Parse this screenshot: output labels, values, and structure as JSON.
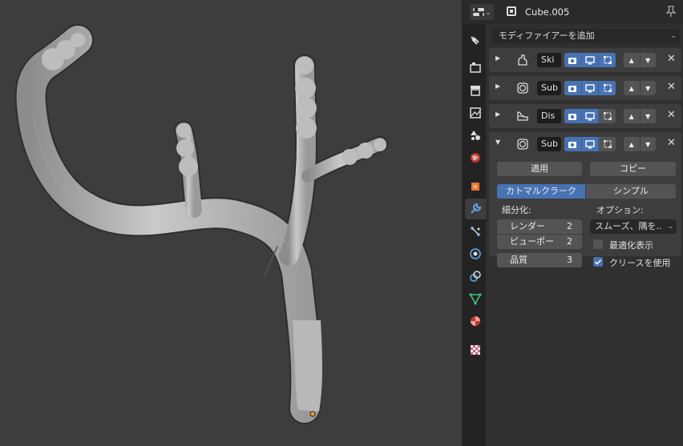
{
  "header": {
    "object_name": "Cube.005"
  },
  "add_modifier": {
    "label": "モディファイアーを追加"
  },
  "modifiers": [
    {
      "name": "Ski",
      "icon": "skin-modifier-icon",
      "expanded": false
    },
    {
      "name": "Sub",
      "icon": "subdivision-modifier-icon",
      "expanded": false
    },
    {
      "name": "Dis",
      "icon": "displace-modifier-icon",
      "expanded": false
    },
    {
      "name": "Sub",
      "icon": "subdivision-modifier-icon",
      "expanded": true
    }
  ],
  "subdivision_panel": {
    "apply_label": "適用",
    "copy_label": "コピー",
    "catmull_clark_label": "カトマルクラーク",
    "simple_label": "シンプル",
    "subdivisions_label": "細分化:",
    "render_label": "レンダー",
    "render_value": "2",
    "viewport_label": "ビューポー",
    "viewport_value": "2",
    "quality_label": "品質",
    "quality_value": "3",
    "options_label": "オプション:",
    "uv_smooth_value": "スムーズ、隅を..",
    "optimal_display_label": "最適化表示",
    "optimal_display_checked": false,
    "use_creases_label": "クリースを使用",
    "use_creases_checked": true
  },
  "colors": {
    "accent": "#4772b3",
    "viewport_bg": "#3d3d3d",
    "panel_bg": "#303030"
  }
}
